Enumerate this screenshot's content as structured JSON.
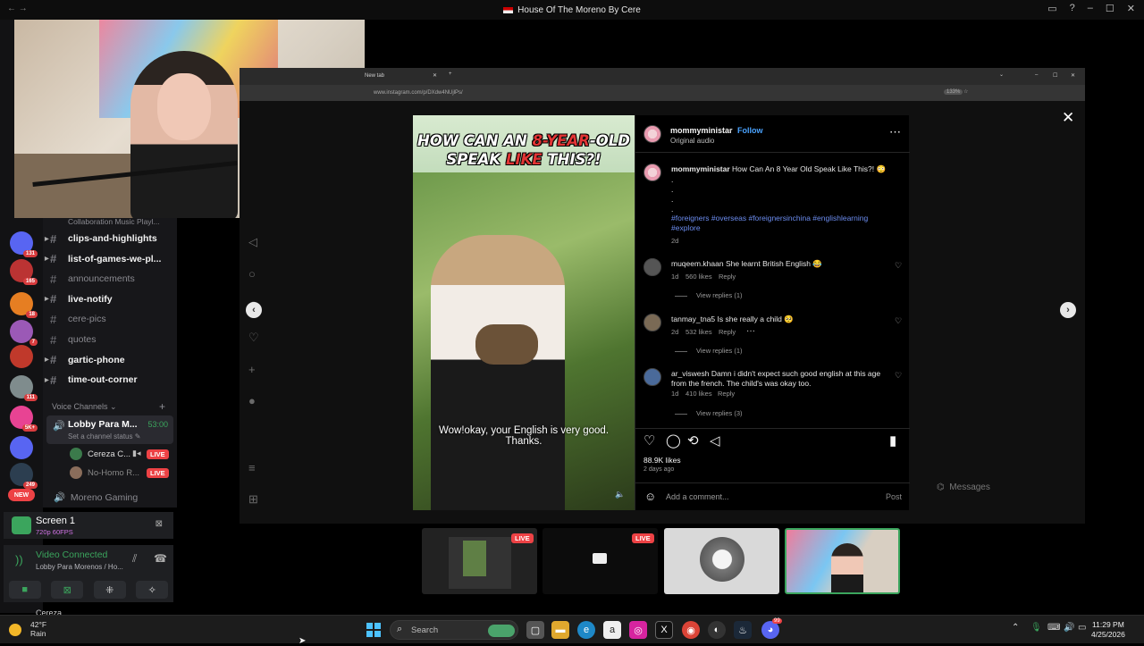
{
  "window": {
    "title": "House Of The Moreno By Cere"
  },
  "discord": {
    "servers": [
      {
        "badge": "131",
        "color": "#5865f2"
      },
      {
        "badge": "165",
        "color": "#b33"
      },
      {
        "badge": "18",
        "color": "#e67e22"
      },
      {
        "badge": "7",
        "color": "#9b59b6"
      },
      {
        "badge": "",
        "color": "#c0392b"
      },
      {
        "badge": "111",
        "color": "#7f8c8d"
      },
      {
        "badge": "5K+",
        "color": "#e84393"
      },
      {
        "badge": "",
        "color": "#5865f2"
      },
      {
        "badge": "249",
        "color": "#2c3e50"
      },
      {
        "badge": "NEW",
        "color": "#ed4245"
      }
    ],
    "channels_cut": "Collaboration Music Playl...",
    "channels": [
      {
        "name": "clips-and-highlights",
        "bold": true,
        "arrow": true
      },
      {
        "name": "list-of-games-we-pl...",
        "bold": true,
        "arrow": true
      },
      {
        "name": "announcements",
        "bold": false,
        "arrow": false
      },
      {
        "name": "live-notify",
        "bold": true,
        "arrow": true
      },
      {
        "name": "cere-pics",
        "bold": false,
        "arrow": false
      },
      {
        "name": "quotes",
        "bold": false,
        "arrow": false
      },
      {
        "name": "gartic-phone",
        "bold": true,
        "arrow": true
      },
      {
        "name": "time-out-corner",
        "bold": true,
        "arrow": true
      }
    ],
    "voice_header": "Voice Channels",
    "lobby": {
      "name": "Lobby Para M...",
      "time": "53:00",
      "status": "Set a channel status"
    },
    "members": [
      {
        "name": "Cereza C...",
        "live": "LIVE"
      },
      {
        "name": "No-Homo R...",
        "live": "LIVE"
      }
    ],
    "other_voice": "Moreno Gaming",
    "screen": {
      "title": "Screen 1",
      "quality": "720p 60FPS"
    },
    "video": {
      "status": "Video Connected",
      "channel": "Lobby Para Morenos / Ho..."
    },
    "user_cut": "Cereza"
  },
  "browser": {
    "tab": "New tab",
    "url": "www.instagram.com/p/DXdw4NUjlPs/",
    "zoom": "133%"
  },
  "instagram": {
    "reel_title_parts": [
      "HOW CAN AN ",
      "8-YEAR",
      "-OLD SPEAK ",
      "LIKE",
      " THIS?!"
    ],
    "caption": "Wow!okay, your English is very good. Thanks.",
    "author": "mommyministar",
    "follow": "Follow",
    "audio": "Original audio",
    "post_text": "How Can An 8 Year Old Speak Like This?! 😳",
    "dots": [
      ".",
      ".",
      ".",
      "."
    ],
    "tags_line1": "#foreigners #overseas #foreignersinchina #englishlearning",
    "tags_line2": "#explore",
    "post_age": "2d",
    "comments": [
      {
        "user": "muqeem.khaan",
        "text": "She learnt British English 😂",
        "age": "1d",
        "likes": "560 likes",
        "reply": "Reply",
        "view": "View replies (1)"
      },
      {
        "user": "tanmay_tna5",
        "text": "Is she really a child 🥺",
        "age": "2d",
        "likes": "532 likes",
        "reply": "Reply",
        "view": "View replies (1)"
      },
      {
        "user": "ar_viswesh",
        "text": "Damn i didn't expect such good english at this age from the french. The child's was okay too.",
        "age": "1d",
        "likes": "410 likes",
        "reply": "Reply",
        "view": "View replies (3)"
      }
    ],
    "likes": "88.9K likes",
    "ago": "2 days ago",
    "comment_placeholder": "Add a comment...",
    "post_button": "Post",
    "messages": "Messages"
  },
  "stream_thumbs": [
    {
      "live": "LIVE"
    },
    {
      "live": "LIVE"
    },
    {
      "live": ""
    },
    {
      "live": ""
    }
  ],
  "taskbar": {
    "weather_temp": "42°F",
    "weather_cond": "Rain",
    "search_placeholder": "Search",
    "time": "11:29 PM",
    "date": "4/25/2026",
    "discord_badge": "99"
  }
}
